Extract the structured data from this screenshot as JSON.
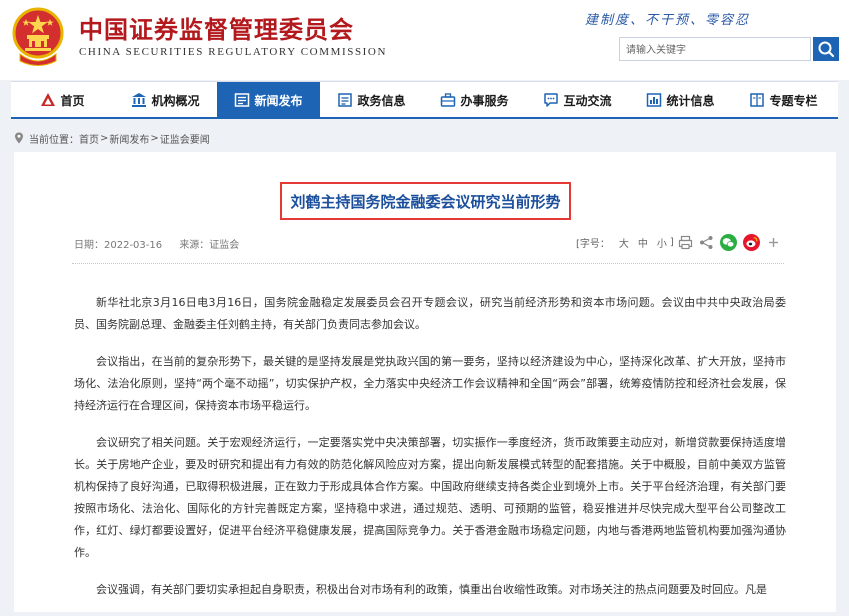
{
  "header": {
    "title": "中国证券监督管理委员会",
    "subtitle": "CHINA SECURITIES REGULATORY COMMISSION",
    "slogan": "建制度、不干预、零容忍",
    "search_placeholder": "请输入关键字"
  },
  "colors": {
    "brand_red": "#b3181c",
    "nav_blue": "#1e64b4",
    "highlight_red": "#e53935",
    "title_blue": "#1b4f9c"
  },
  "nav": {
    "items": [
      {
        "label": "首页",
        "icon": "home-icon"
      },
      {
        "label": "机构概况",
        "icon": "building-icon"
      },
      {
        "label": "新闻发布",
        "icon": "news-icon",
        "active": true
      },
      {
        "label": "政务信息",
        "icon": "document-icon"
      },
      {
        "label": "办事服务",
        "icon": "briefcase-icon"
      },
      {
        "label": "互动交流",
        "icon": "chat-icon"
      },
      {
        "label": "统计信息",
        "icon": "chart-icon"
      },
      {
        "label": "专题专栏",
        "icon": "book-icon"
      }
    ]
  },
  "breadcrumb": {
    "prefix": "当前位置：",
    "items": [
      "首页",
      "新闻发布",
      "证监会要闻"
    ],
    "separator": ">"
  },
  "article": {
    "title": "刘鹤主持国务院金融委会议研究当前形势",
    "date_label": "日期：2022-03-16",
    "source_label": "来源：证监会",
    "font_size_label": "[字号：",
    "size_large": "大",
    "size_medium": "中",
    "size_small": "小",
    "font_size_close": "]",
    "paragraphs": [
      "新华社北京3月16日电3月16日，国务院金融稳定发展委员会召开专题会议，研究当前经济形势和资本市场问题。会议由中共中央政治局委员、国务院副总理、金融委主任刘鹤主持，有关部门负责同志参加会议。",
      "会议指出，在当前的复杂形势下，最关键的是坚持发展是党执政兴国的第一要务，坚持以经济建设为中心，坚持深化改革、扩大开放，坚持市场化、法治化原则，坚持“两个毫不动摇”，切实保护产权，全力落实中央经济工作会议精神和全国“两会”部署，统筹疫情防控和经济社会发展，保持经济运行在合理区间，保持资本市场平稳运行。",
      "会议研究了相关问题。关于宏观经济运行，一定要落实党中央决策部署，切实振作一季度经济，货币政策要主动应对，新增贷款要保持适度增长。关于房地产企业，要及时研究和提出有力有效的防范化解风险应对方案，提出向新发展模式转型的配套措施。关于中概股，目前中美双方监管机构保持了良好沟通，已取得积极进展，正在致力于形成具体合作方案。中国政府继续支持各类企业到境外上市。关于平台经济治理，有关部门要按照市场化、法治化、国际化的方针完善既定方案，坚持稳中求进，通过规范、透明、可预期的监管，稳妥推进并尽快完成大型平台公司整改工作，红灯、绿灯都要设置好，促进平台经济平稳健康发展，提高国际竞争力。关于香港金融市场稳定问题，内地与香港两地监管机构要加强沟通协作。",
      "会议强调，有关部门要切实承担起自身职责，积极出台对市场有利的政策，慎重出台收缩性政策。对市场关注的热点问题要及时回应。凡是"
    ]
  }
}
